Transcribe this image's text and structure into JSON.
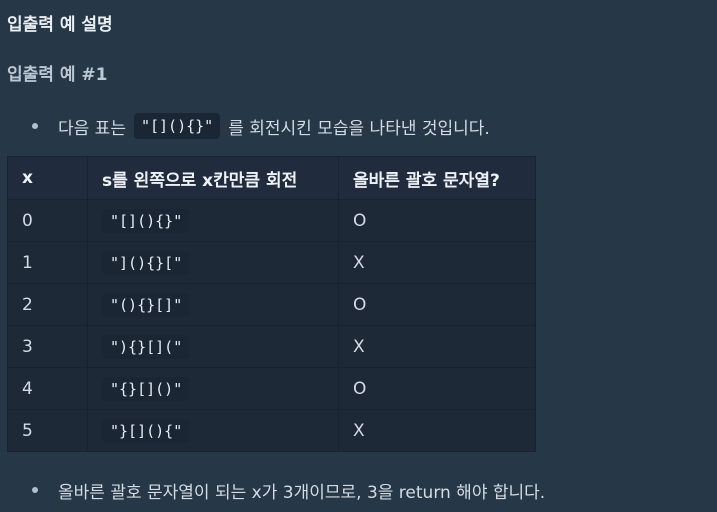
{
  "section_title": "입출력 예 설명",
  "example_title": "입출력 예 #1",
  "intro": {
    "prefix": "다음 표는",
    "code": "\"[](){}\"",
    "suffix": "를 회전시킨 모습을 나타낸 것입니다."
  },
  "table": {
    "headers": [
      "x",
      "s를 왼쪽으로 x칸만큼 회전",
      "올바른 괄호 문자열?"
    ],
    "rows": [
      {
        "x": "0",
        "s": "\"[](){}\"",
        "valid": "O"
      },
      {
        "x": "1",
        "s": "\"](){}[\"",
        "valid": "X"
      },
      {
        "x": "2",
        "s": "\"(){}[]\"",
        "valid": "O"
      },
      {
        "x": "3",
        "s": "\"){}[](\"",
        "valid": "X"
      },
      {
        "x": "4",
        "s": "\"{}[]()\"",
        "valid": "O"
      },
      {
        "x": "5",
        "s": "\"}[](){\"",
        "valid": "X"
      }
    ]
  },
  "conclusion": "올바른 괄호 문자열이 되는 x가 3개이므로, 3을 return 해야 합니다."
}
